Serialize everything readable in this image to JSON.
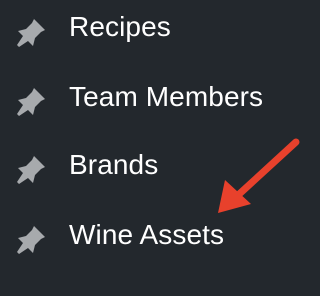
{
  "menu": {
    "items": [
      {
        "label": "Recipes",
        "icon": "pin-icon"
      },
      {
        "label": "Team Members",
        "icon": "pin-icon"
      },
      {
        "label": "Brands",
        "icon": "pin-icon"
      },
      {
        "label": "Wine Assets",
        "icon": "pin-icon"
      }
    ]
  },
  "colors": {
    "background": "#23282d",
    "text": "#ffffff",
    "icon": "#a7aaad",
    "annotation_arrow": "#e8412c"
  }
}
